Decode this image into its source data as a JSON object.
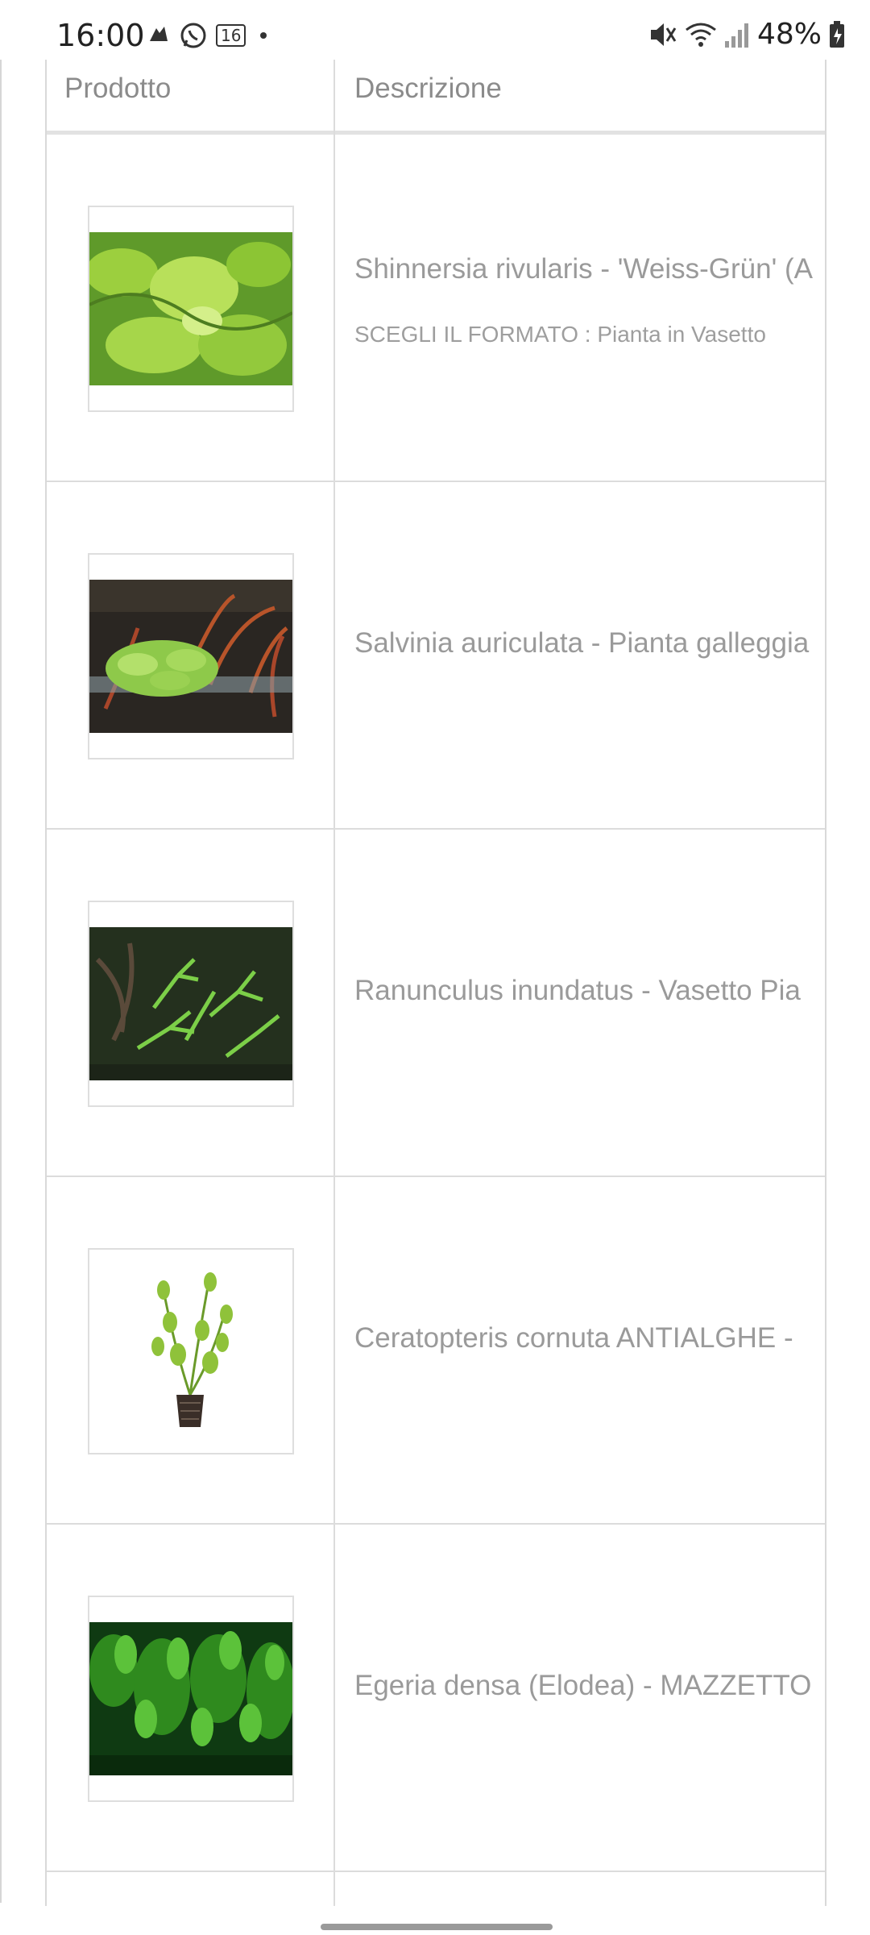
{
  "status_bar": {
    "time": "16:00",
    "notif_badge": "16",
    "battery": "48%"
  },
  "table": {
    "headers": {
      "product": "Prodotto",
      "description": "Descrizione"
    },
    "rows": [
      {
        "title": "Shinnersia rivularis - 'Weiss-Grün' (A",
        "variant": "SCEGLI IL FORMATO : Pianta in Vasetto"
      },
      {
        "title": "Salvinia auriculata - Pianta galleggia",
        "variant": ""
      },
      {
        "title": "Ranunculus inundatus - Vasetto Pia",
        "variant": ""
      },
      {
        "title": "Ceratopteris cornuta ANTIALGHE -",
        "variant": ""
      },
      {
        "title": "Egeria densa (Elodea) - MAZZETTO",
        "variant": ""
      }
    ]
  }
}
